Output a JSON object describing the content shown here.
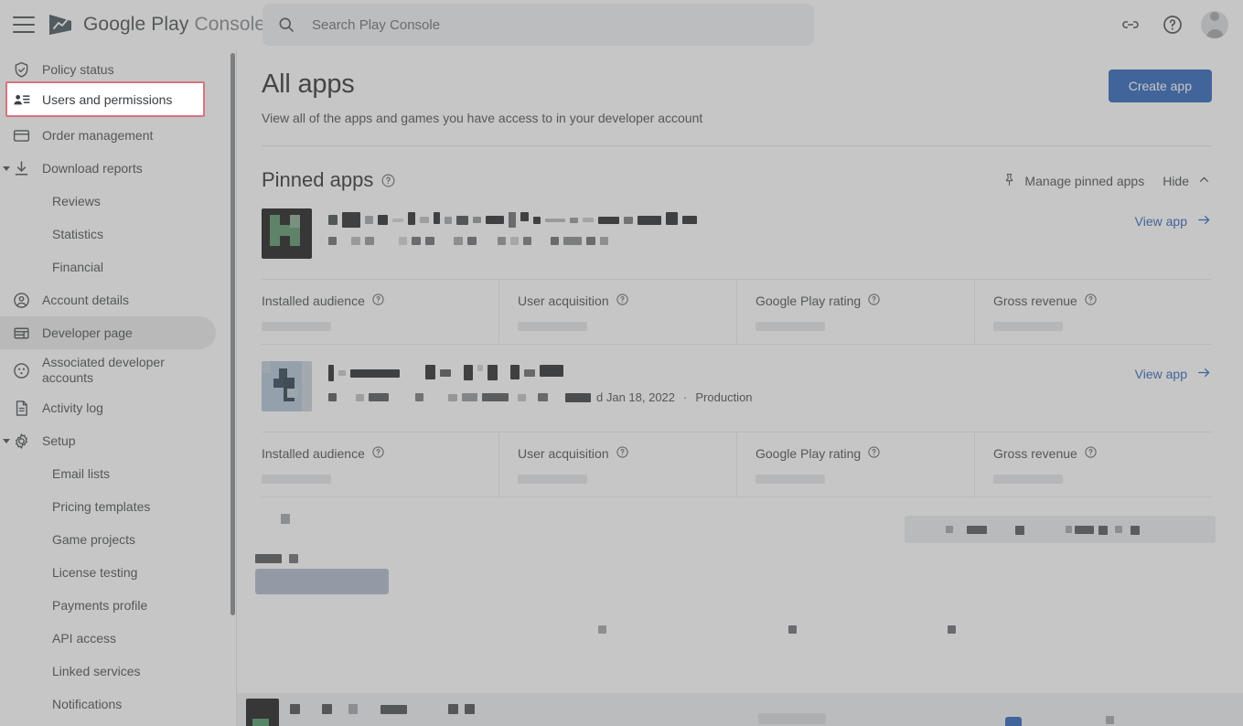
{
  "app": {
    "brand_primary": "Google Play",
    "brand_secondary": "Console",
    "accent_blue": "#1a56b4",
    "highlight_border": "#d4757f"
  },
  "topbar": {
    "menu_icon": "hamburger-icon",
    "logo_icon": "google-play-logo",
    "search": {
      "icon": "search-icon",
      "placeholder": "Search Play Console",
      "value": ""
    },
    "actions": [
      {
        "name": "link-icon",
        "label": ""
      },
      {
        "name": "help-icon",
        "label": ""
      },
      {
        "name": "account-avatar",
        "label": ""
      }
    ]
  },
  "sidebar": {
    "items": [
      {
        "label": "Policy status",
        "icon": "shield-check-icon",
        "level": "top",
        "caret": false,
        "state": "normal"
      },
      {
        "label": "Users and permissions",
        "icon": "users-icon",
        "level": "top",
        "caret": false,
        "state": "highlighted"
      },
      {
        "label": "Order management",
        "icon": "credit-card-icon",
        "level": "top",
        "caret": false,
        "state": "normal"
      },
      {
        "label": "Download reports",
        "icon": "download-icon",
        "level": "top",
        "caret": true,
        "state": "normal"
      },
      {
        "label": "Reviews",
        "icon": "",
        "level": "sub",
        "caret": false,
        "state": "normal"
      },
      {
        "label": "Statistics",
        "icon": "",
        "level": "sub",
        "caret": false,
        "state": "normal"
      },
      {
        "label": "Financial",
        "icon": "",
        "level": "sub",
        "caret": false,
        "state": "normal"
      },
      {
        "label": "Account details",
        "icon": "account-circle-icon",
        "level": "top",
        "caret": false,
        "state": "normal"
      },
      {
        "label": "Developer page",
        "icon": "layout-icon",
        "level": "top",
        "caret": false,
        "state": "hover"
      },
      {
        "label": "Associated developer accounts",
        "icon": "associated-accounts-icon",
        "level": "top",
        "caret": false,
        "state": "normal"
      },
      {
        "label": "Activity log",
        "icon": "document-icon",
        "level": "top",
        "caret": false,
        "state": "normal"
      },
      {
        "label": "Setup",
        "icon": "gear-icon",
        "level": "top",
        "caret": true,
        "state": "normal"
      },
      {
        "label": "Email lists",
        "icon": "",
        "level": "sub",
        "caret": false,
        "state": "normal"
      },
      {
        "label": "Pricing templates",
        "icon": "",
        "level": "sub",
        "caret": false,
        "state": "normal"
      },
      {
        "label": "Game projects",
        "icon": "",
        "level": "sub",
        "caret": false,
        "state": "normal"
      },
      {
        "label": "License testing",
        "icon": "",
        "level": "sub",
        "caret": false,
        "state": "normal"
      },
      {
        "label": "Payments profile",
        "icon": "",
        "level": "sub",
        "caret": false,
        "state": "normal"
      },
      {
        "label": "API access",
        "icon": "",
        "level": "sub",
        "caret": false,
        "state": "normal"
      },
      {
        "label": "Linked services",
        "icon": "",
        "level": "sub",
        "caret": false,
        "state": "normal"
      },
      {
        "label": "Notifications",
        "icon": "",
        "level": "sub",
        "caret": false,
        "state": "normal"
      }
    ]
  },
  "main": {
    "page_title": "All apps",
    "page_subtitle": "View all of the apps and games you have access to in your developer account",
    "create_app_label": "Create app",
    "pinned_section": {
      "title": "Pinned apps",
      "help_icon": "help-circle-icon",
      "manage_label": "Manage pinned apps",
      "manage_icon": "pin-icon",
      "hide_label": "Hide",
      "hide_icon": "chevron-up-icon"
    },
    "metric_labels": {
      "installed_audience": "Installed audience",
      "user_acquisition": "User acquisition",
      "google_play_rating": "Google Play rating",
      "gross_revenue": "Gross revenue"
    },
    "view_app_label": "View app",
    "view_app_icon": "arrow-right-icon",
    "apps": [
      {
        "name_redacted": true,
        "icon_style": "green-black-redacted",
        "subtitle_visible": "",
        "status": ""
      },
      {
        "name_redacted": true,
        "icon_style": "light-blue-redacted",
        "subtitle_visible": "d Jan 18, 2022",
        "separator": "·",
        "status": "Production"
      }
    ]
  }
}
